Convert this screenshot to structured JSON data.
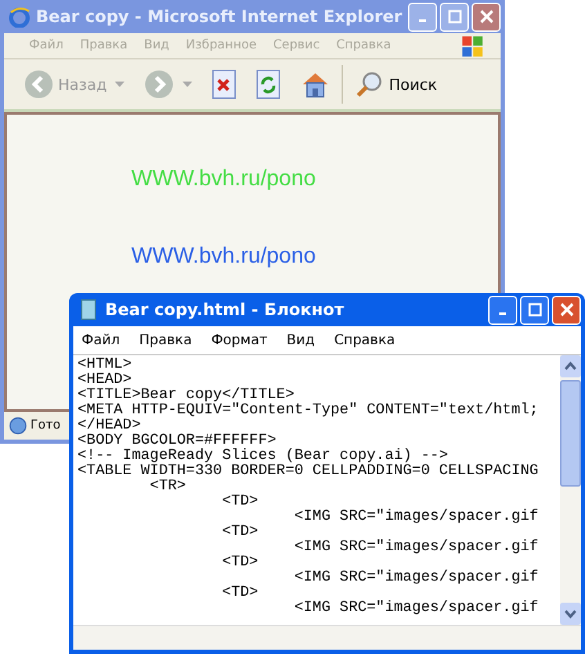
{
  "browser": {
    "title": "Bear copy - Microsoft Internet Explorer",
    "menu": [
      "Файл",
      "Правка",
      "Вид",
      "Избранное",
      "Сервис",
      "Справка"
    ],
    "toolbar": {
      "back": "Назад",
      "search": "Поиск"
    },
    "page_links": [
      {
        "text": "WWW.bvh.ru/pono",
        "color": "#44dd44"
      },
      {
        "text": "WWW.bvh.ru/pono",
        "color": "#2a5fe6"
      }
    ],
    "status": "Гото"
  },
  "notepad": {
    "title": "Bear copy.html - Блокнот",
    "menu": [
      "Файл",
      "Правка",
      "Формат",
      "Вид",
      "Справка"
    ],
    "lines": [
      "<HTML>",
      "<HEAD>",
      "<TITLE>Bear copy</TITLE>",
      "<META HTTP-EQUIV=\"Content-Type\" CONTENT=\"text/html;",
      "</HEAD>",
      "<BODY BGCOLOR=#FFFFFF>",
      "<!-- ImageReady Slices (Bear copy.ai) -->",
      "<TABLE WIDTH=330 BORDER=0 CELLPADDING=0 CELLSPACING",
      "\t<TR>",
      "\t\t<TD>",
      "\t\t\t<IMG SRC=\"images/spacer.gif",
      "\t\t<TD>",
      "\t\t\t<IMG SRC=\"images/spacer.gif",
      "\t\t<TD>",
      "\t\t\t<IMG SRC=\"images/spacer.gif",
      "\t\t<TD>",
      "\t\t\t<IMG SRC=\"images/spacer.gif"
    ]
  }
}
